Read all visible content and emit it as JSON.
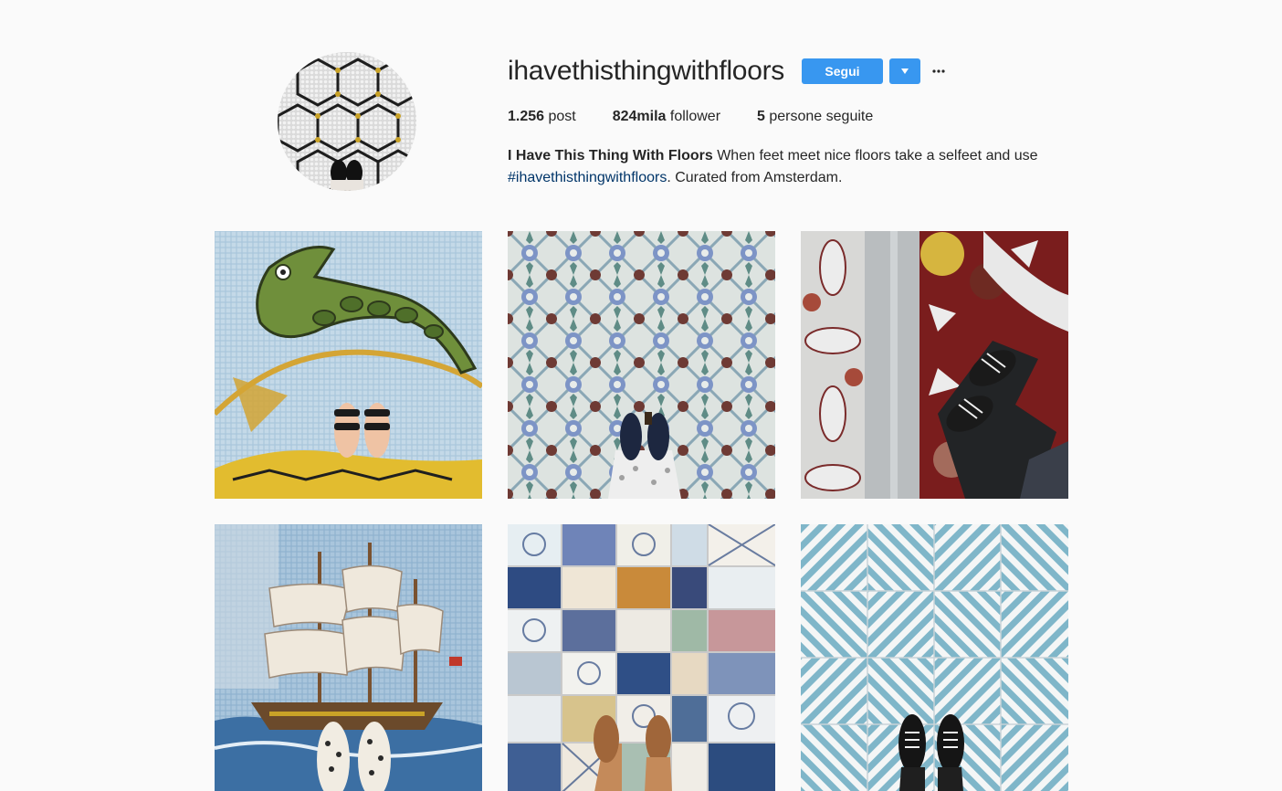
{
  "profile": {
    "username": "ihavethisthingwithfloors",
    "follow_label": "Segui",
    "dropdown_glyph": "▾",
    "more_glyph": "···",
    "stats": {
      "posts_value": "1.256",
      "posts_label": " post",
      "followers_value": "824mila",
      "followers_label": " follower",
      "following_value": "5",
      "following_label": " persone seguite"
    },
    "bio": {
      "name": "I Have This Thing With Floors",
      "text": " When feet meet nice floors take a selfeet and use ",
      "hashtag": "#ihavethisthingwithfloors",
      "suffix": ". Curated from Amsterdam."
    }
  },
  "colors": {
    "accent": "#3897f0",
    "link": "#003569",
    "background": "#fafafa"
  },
  "icons": {
    "avatar": "hexagon-tile-floor-image",
    "dropdown": "caret-down-icon",
    "more": "ellipsis-icon"
  },
  "posts": [
    {
      "subject": "seahorse mosaic floor with sandals"
    },
    {
      "subject": "blue patterned cement tiles with loafers"
    },
    {
      "subject": "marble inlay floor with sneakers"
    },
    {
      "subject": "sailing ship mosaic with slip-ons"
    },
    {
      "subject": "mixed patchwork tiles with brown shoes"
    },
    {
      "subject": "blue chevron stripe tiles with sneakers"
    }
  ]
}
